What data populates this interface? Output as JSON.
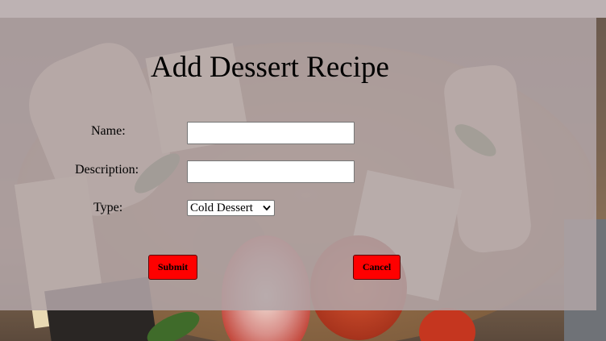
{
  "page": {
    "title": "Add Dessert Recipe"
  },
  "form": {
    "name_label": "Name:",
    "name_value": "",
    "description_label": "Description:",
    "description_value": "",
    "type_label": "Type:",
    "type_selected": "Cold Dessert",
    "submit_label": "Submit",
    "cancel_label": "Cancel"
  },
  "colors": {
    "overlay": "#b0a4a6",
    "button": "#ff0000"
  },
  "icons": {
    "type_dropdown": "chevron-down-icon"
  }
}
